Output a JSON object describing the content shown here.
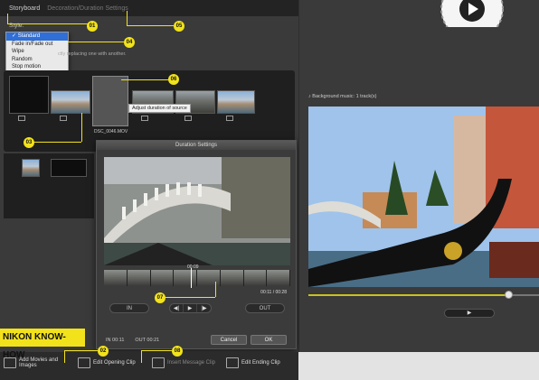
{
  "tabs": [
    "Storyboard",
    "Decoration/Duration Settings"
  ],
  "style": {
    "label": "Style:",
    "options": [
      "✓ Standard",
      "Fade in/Fade out",
      "Wipe",
      "Random",
      "Stop motion"
    ],
    "hint": "ctly replacing one with another."
  },
  "storyboard": {
    "tooltip": "Adjust duration of source",
    "selected_file": "DSC_0046.MOV"
  },
  "duration_dialog": {
    "title": "Duration Settings",
    "timecode_top": "00:09",
    "timecode_right": "00:11 / 00:28",
    "in_button": "IN",
    "out_button": "OUT",
    "controls": [
      "◀|",
      "▶",
      "|▶"
    ],
    "in_time": "IN 00:11",
    "out_time": "OUT 00:21",
    "cancel": "Cancel",
    "ok": "OK"
  },
  "preview": {
    "background_music": "♪ Background music: 1 track(s)",
    "play": "▶",
    "seek_progress": 0.87
  },
  "bottom_bar": {
    "items": [
      {
        "label": "Add Movies and\nImages"
      },
      {
        "label": "Edit Opening Clip"
      },
      {
        "label": "Insert Message Clip"
      },
      {
        "label": "Edit Ending Clip"
      }
    ]
  },
  "brand_tag": "NIKON KNOW-HOW",
  "callouts": [
    "01",
    "02",
    "03",
    "04",
    "05",
    "06",
    "07",
    "08"
  ],
  "colors": {
    "accent": "#f2e21b",
    "selection": "#2f6fd7"
  }
}
